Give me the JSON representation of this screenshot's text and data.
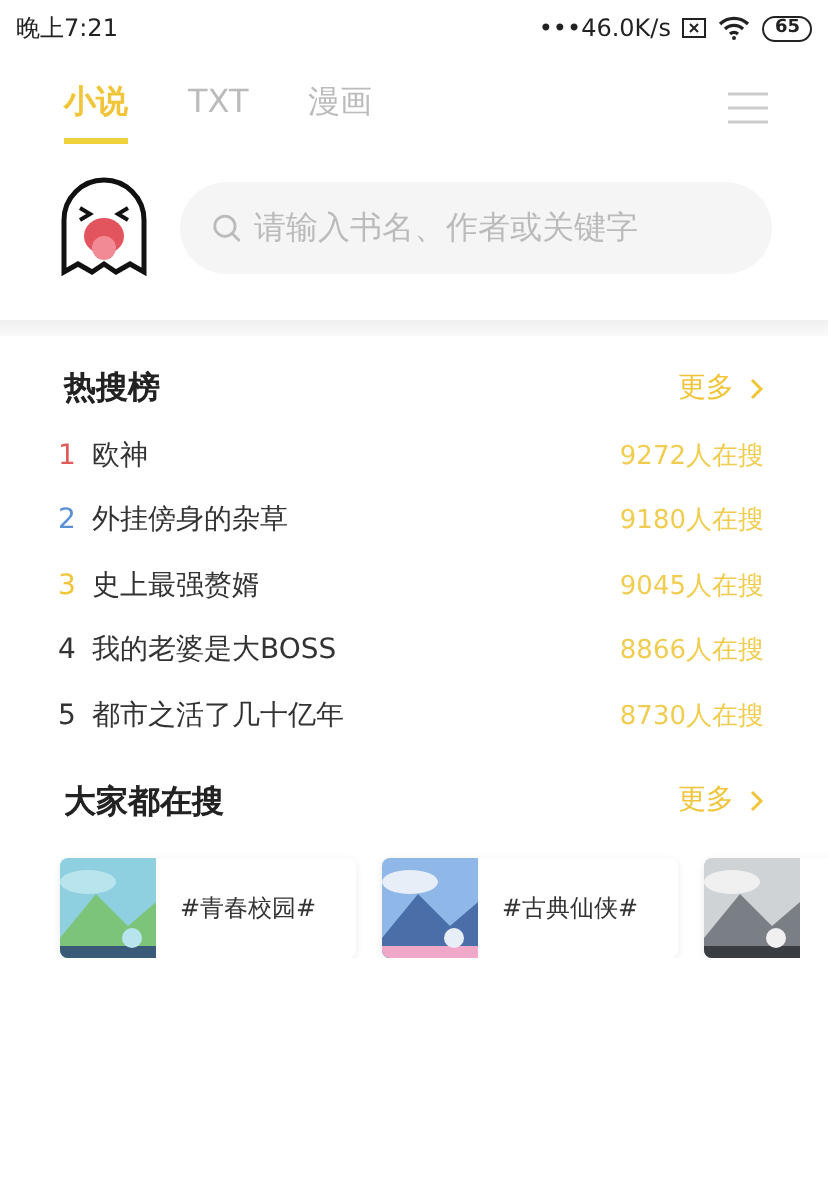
{
  "status_bar": {
    "time": "晚上7:21",
    "speed": "•••46.0K/s",
    "battery": "65"
  },
  "tabs": [
    {
      "label": "小说",
      "selected": true
    },
    {
      "label": "TXT",
      "selected": false
    },
    {
      "label": "漫画",
      "selected": false
    }
  ],
  "search": {
    "placeholder": "请输入书名、作者或关键字"
  },
  "hot_list": {
    "title": "热搜榜",
    "more": "更多",
    "items": [
      {
        "rank": "1",
        "color": "#e05a5a",
        "title": "欧神",
        "count": "9272人在搜"
      },
      {
        "rank": "2",
        "color": "#5b8fd6",
        "title": "外挂傍身的杂草",
        "count": "9180人在搜"
      },
      {
        "rank": "3",
        "color": "#f0c53a",
        "title": "史上最强赘婿",
        "count": "9045人在搜"
      },
      {
        "rank": "4",
        "color": "#333333",
        "title": "我的老婆是大BOSS",
        "count": "8866人在搜"
      },
      {
        "rank": "5",
        "color": "#333333",
        "title": "都市之活了几十亿年",
        "count": "8730人在搜"
      }
    ]
  },
  "popular": {
    "title": "大家都在搜",
    "more": "更多",
    "cards": [
      {
        "label": "#青春校园#",
        "kind": "picture"
      },
      {
        "label": "#古典仙侠#",
        "kind": "picture"
      },
      {
        "kind": "picture"
      }
    ]
  }
}
